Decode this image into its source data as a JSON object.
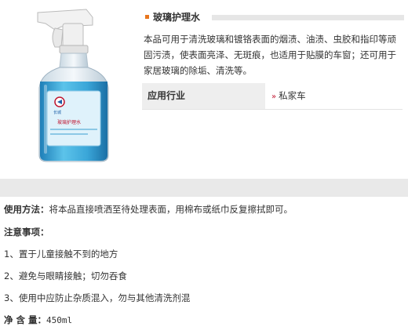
{
  "product": {
    "title": "玻璃护理水",
    "description": "本品可用于清洗玻璃和镀铬表面的烟渍、油渍、虫胶和指印等顽固污渍，使表面亮泽、无斑痕，也适用于贴膜的车窗；还可用于家居玻璃的除垢、清洗等。",
    "image_icon": "spray-bottle-icon",
    "bottle_label": {
      "brand": "长城",
      "name": "玻璃护理水"
    }
  },
  "industry": {
    "label": "应用行业",
    "value": "私家车",
    "arrow_icon": "double-chevron-right-icon"
  },
  "usage": {
    "label": "使用方法：",
    "text": "将本品直接喷洒至待处理表面，用棉布或纸巾反复擦拭即可。"
  },
  "notes": {
    "label": "注意事项：",
    "items": [
      "1、置于儿童接触不到的地方",
      "2、避免与眼睛接触；切勿吞食",
      "3、使用中应防止杂质混入，勿与其他清洗剂混"
    ]
  },
  "net_content": {
    "label": "净 含 量：",
    "value": "450ml"
  },
  "colors": {
    "accent_orange": "#e8761e",
    "arrow_red": "#c0152f",
    "liquid_blue": "#3aa6d8"
  }
}
